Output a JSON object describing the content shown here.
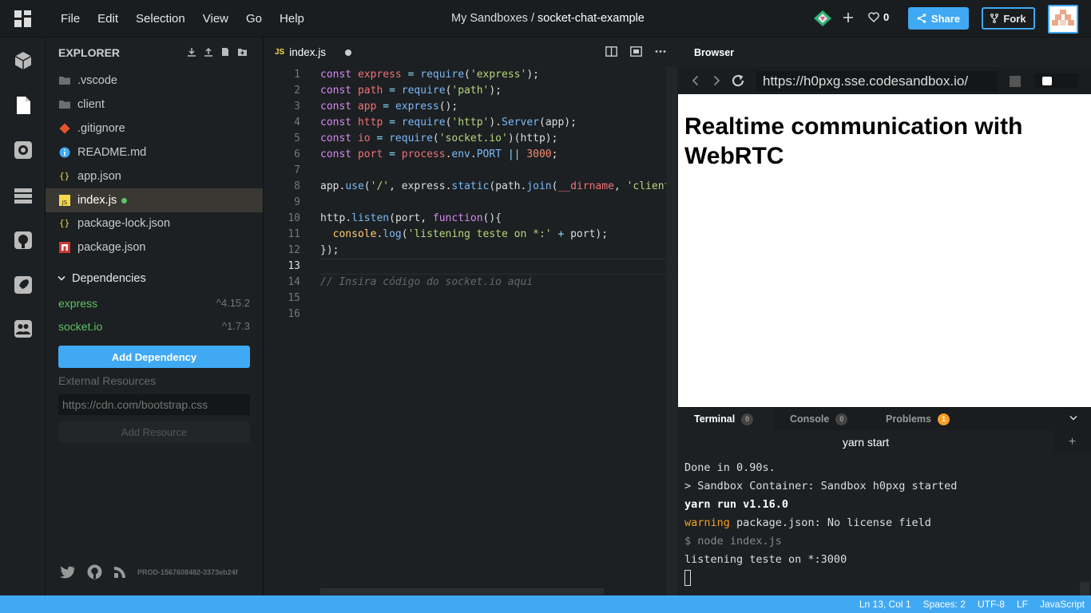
{
  "menu": [
    "File",
    "Edit",
    "Selection",
    "View",
    "Go",
    "Help"
  ],
  "title": {
    "prefix": "My Sandboxes /",
    "name": "socket-chat-example"
  },
  "toolbar": {
    "likes": "0",
    "share": "Share",
    "fork": "Fork"
  },
  "sidebar": {
    "title": "EXPLORER",
    "files": [
      {
        "name": ".vscode",
        "icon": "folder-icon"
      },
      {
        "name": "client",
        "icon": "folder-icon"
      },
      {
        "name": ".gitignore",
        "icon": "git-icon"
      },
      {
        "name": "README.md",
        "icon": "info-icon"
      },
      {
        "name": "app.json",
        "icon": "json-icon"
      },
      {
        "name": "index.js",
        "icon": "js-icon"
      },
      {
        "name": "package-lock.json",
        "icon": "json-icon"
      },
      {
        "name": "package.json",
        "icon": "npm-icon"
      }
    ],
    "dependencies_label": "Dependencies",
    "dependencies": [
      {
        "name": "express",
        "version": "^4.15.2"
      },
      {
        "name": "socket.io",
        "version": "^1.7.3"
      }
    ],
    "add_dependency": "Add Dependency",
    "external_resources": "External Resources",
    "resource_placeholder": "https://cdn.com/bootstrap.css",
    "add_resource": "Add Resource",
    "build": "PROD-1567608482-3373eb24f"
  },
  "editor": {
    "tab_badge": "JS",
    "tab": "index.js",
    "line_numbers": [
      "1",
      "2",
      "3",
      "4",
      "5",
      "6",
      "7",
      "8",
      "9",
      "10",
      "11",
      "12",
      "13",
      "14",
      "15",
      "16"
    ],
    "code": [
      "const express = require('express');",
      "const path = require('path');",
      "const app = express();",
      "const http = require('http').Server(app);",
      "const io = require('socket.io')(http);",
      "const port = process.env.PORT || 3000;",
      "",
      "app.use('/', express.static(path.join(__dirname, 'client')));",
      "",
      "http.listen(port, function(){",
      "  console.log('listening teste on *:' + port);",
      "});",
      "",
      "// Insira código do socket.io aqui",
      "",
      ""
    ]
  },
  "browser": {
    "tab": "Browser",
    "url": "https://h0pxg.sse.codesandbox.io/",
    "heading": "Realtime communication with WebRTC"
  },
  "terminal": {
    "tabs": [
      {
        "label": "Terminal",
        "count": "0"
      },
      {
        "label": "Console",
        "count": "0"
      },
      {
        "label": "Problems",
        "count": "1"
      }
    ],
    "subtab": "yarn start",
    "lines": [
      "Done in 0.90s.",
      "> Sandbox Container: Sandbox h0pxg started",
      "yarn run v1.16.0",
      "warning package.json: No license field",
      "$ node index.js",
      "listening teste on *:3000"
    ]
  },
  "status": {
    "position": "Ln 13, Col 1",
    "spaces": "Spaces: 2",
    "encoding": "UTF-8",
    "eol": "LF",
    "language": "JavaScript"
  },
  "colors": {
    "accent": "#40a9f3",
    "dep": "#5bc266",
    "warning": "#f59e26"
  }
}
